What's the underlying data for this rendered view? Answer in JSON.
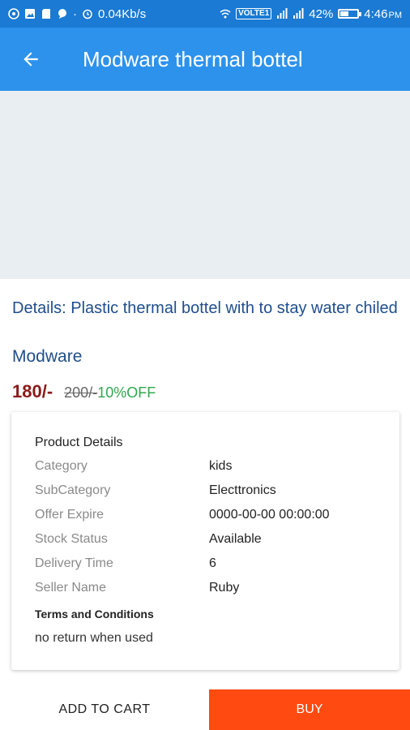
{
  "status_bar": {
    "speed": "0.04Kb/s",
    "volte": "VOLTE1",
    "battery_percent": "42%",
    "battery_level": 0.42,
    "time": "4:46",
    "time_suffix": "PM"
  },
  "app_bar": {
    "title": "Modware thermal bottel"
  },
  "product": {
    "details": "Details: Plastic thermal bottel with to stay water chiled",
    "brand": "Modware",
    "price": "180/-",
    "old_price": "200/-",
    "discount": "10%OFF"
  },
  "card": {
    "title": "Product Details",
    "rows": [
      {
        "key": "Category",
        "value": "kids"
      },
      {
        "key": "SubCategory",
        "value": "Electtronics"
      },
      {
        "key": "Offer Expire",
        "value": "0000-00-00 00:00:00"
      },
      {
        "key": "Stock Status",
        "value": "Available"
      },
      {
        "key": "Delivery Time",
        "value": "6"
      },
      {
        "key": "Seller Name",
        "value": "Ruby"
      }
    ],
    "terms_title": "Terms and Conditions",
    "terms_text": "no return when used"
  },
  "actions": {
    "add_to_cart": "ADD TO CART",
    "buy": "BUY"
  },
  "colors": {
    "status_bar": "#1a7ad4",
    "app_bar": "#2d92ec",
    "buy_button": "#ff4a12",
    "price": "#8b1a1a",
    "discount": "#2ea84f"
  }
}
